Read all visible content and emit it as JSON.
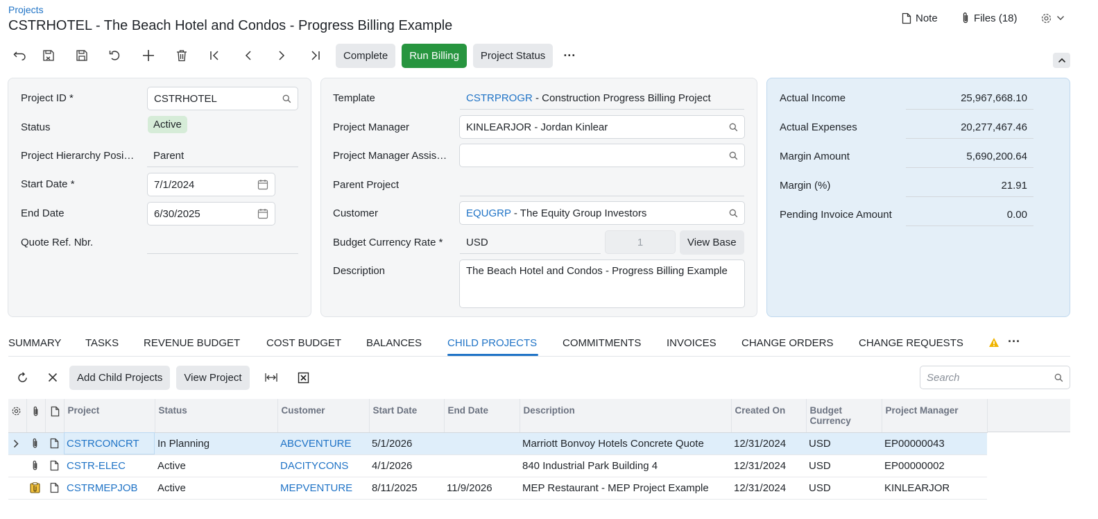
{
  "breadcrumb": "Projects",
  "title": "CSTRHOTEL - The Beach Hotel and Condos - Progress Billing Example",
  "header": {
    "note": "Note",
    "files": "Files (18)"
  },
  "toolbar": {
    "complete": "Complete",
    "run_billing": "Run Billing",
    "project_status": "Project Status",
    "more": "···"
  },
  "summary": {
    "project_id_label": "Project ID",
    "project_id_value": "CSTRHOTEL",
    "status_label": "Status",
    "status_value": "Active",
    "hierarchy_label": "Project Hierarchy Posi…",
    "hierarchy_value": "Parent",
    "start_date_label": "Start Date",
    "start_date_value": "7/1/2024",
    "end_date_label": "End Date",
    "end_date_value": "6/30/2025",
    "quote_label": "Quote Ref. Nbr.",
    "quote_value": ""
  },
  "details": {
    "template_label": "Template",
    "template_code": "CSTRPROGR",
    "template_desc": " - Construction Progress Billing Project",
    "pm_label": "Project Manager",
    "pm_value": "KINLEARJOR - Jordan Kinlear",
    "pm_assist_label": "Project Manager Assis…",
    "pm_assist_value": "",
    "parent_label": "Parent Project",
    "parent_value": "",
    "customer_label": "Customer",
    "customer_code": "EQUGRP",
    "customer_desc": " - The Equity Group Investors",
    "bcr_label": "Budget Currency Rate",
    "bcr_currency": "USD",
    "bcr_rate": "1",
    "view_base": "View Base",
    "desc_label": "Description",
    "desc_value": "The Beach Hotel and Condos - Progress Billing Example"
  },
  "financials": {
    "actual_income_label": "Actual Income",
    "actual_income": "25,967,668.10",
    "actual_expenses_label": "Actual Expenses",
    "actual_expenses": "20,277,467.46",
    "margin_amount_label": "Margin Amount",
    "margin_amount": "5,690,200.64",
    "margin_pct_label": "Margin (%)",
    "margin_pct": "21.91",
    "pending_label": "Pending Invoice Amount",
    "pending": "0.00"
  },
  "tabs": [
    "SUMMARY",
    "TASKS",
    "REVENUE BUDGET",
    "COST BUDGET",
    "BALANCES",
    "CHILD PROJECTS",
    "COMMITMENTS",
    "INVOICES",
    "CHANGE ORDERS",
    "CHANGE REQUESTS"
  ],
  "active_tab": "CHILD PROJECTS",
  "grid_toolbar": {
    "add_child": "Add Child Projects",
    "view_project": "View Project",
    "search_placeholder": "Search"
  },
  "grid": {
    "columns": [
      "Project",
      "Status",
      "Customer",
      "Start Date",
      "End Date",
      "Description",
      "Created On",
      "Budget Currency",
      "Project Manager"
    ],
    "rows": [
      {
        "project": "CSTRCONCRT",
        "status": "In Planning",
        "customer": "ABCVENTURE",
        "start": "5/1/2026",
        "end": "",
        "description": "Marriott Bonvoy Hotels Concrete Quote",
        "created": "12/31/2024",
        "currency": "USD",
        "pm": "EP00000043"
      },
      {
        "project": "CSTR-ELEC",
        "status": "Active",
        "customer": "DACITYCONS",
        "start": "4/1/2026",
        "end": "",
        "description": "840 Industrial Park Building 4",
        "created": "12/31/2024",
        "currency": "USD",
        "pm": "EP00000002"
      },
      {
        "project": "CSTRMEPJOB",
        "status": "Active",
        "customer": "MEPVENTURE",
        "start": "8/11/2025",
        "end": "11/9/2026",
        "description": "MEP Restaurant - MEP Project Example",
        "created": "12/31/2024",
        "currency": "USD",
        "pm": "KINLEARJOR"
      }
    ]
  },
  "colors": {
    "accent": "#1f73c6",
    "primary_button": "#27953f",
    "status_badge": "#d6ecd8",
    "financial_panel": "#e4eff8",
    "warning": "#f0b400"
  }
}
